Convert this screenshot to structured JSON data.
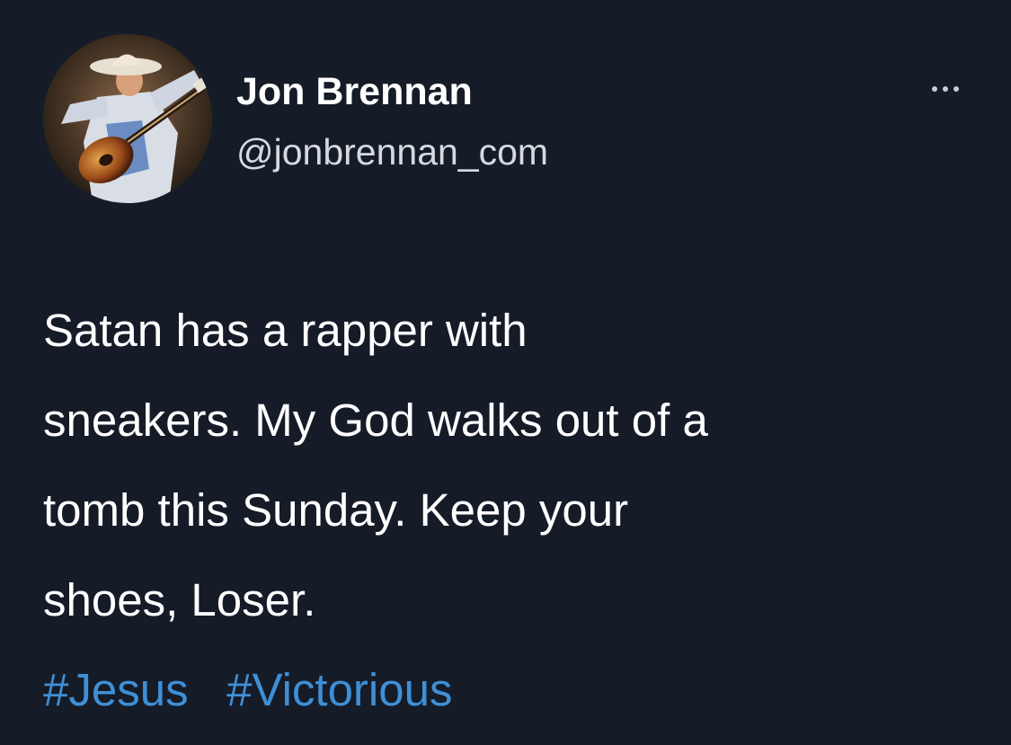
{
  "user": {
    "display_name": "Jon Brennan",
    "handle": "@jonbrennan_com"
  },
  "tweet": {
    "lines": [
      "Satan has a rapper with",
      "sneakers. My God walks out of a",
      "tomb this Sunday. Keep your",
      "shoes, Loser."
    ],
    "hashtags": [
      "#Jesus",
      "#Victorious"
    ]
  },
  "icons": {
    "more": "more-options-icon",
    "avatar": "profile-photo-guitarist"
  },
  "colors": {
    "background": "#151c28",
    "text": "#ffffff",
    "handle": "#d6dae0",
    "hashtag": "#3f8fd6"
  }
}
